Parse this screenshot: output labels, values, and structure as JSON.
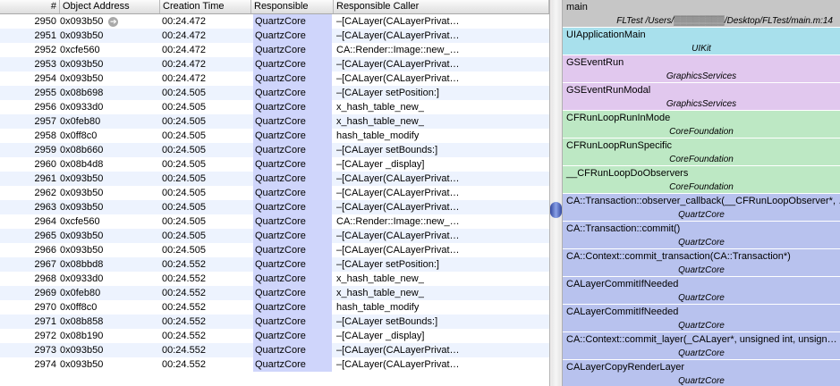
{
  "table": {
    "headers": {
      "num": "#",
      "addr": "Object Address",
      "time": "Creation Time",
      "resp": "Responsible",
      "caller": "Responsible Caller"
    },
    "rows": [
      {
        "num": "2950",
        "addr": "0x093b50",
        "time": "00:24.472",
        "resp": "QuartzCore",
        "caller": "–[CALayer(CALayerPrivat…"
      },
      {
        "num": "2951",
        "addr": "0x093b50",
        "time": "00:24.472",
        "resp": "QuartzCore",
        "caller": "–[CALayer(CALayerPrivat…"
      },
      {
        "num": "2952",
        "addr": "0xcfe560",
        "time": "00:24.472",
        "resp": "QuartzCore",
        "caller": "CA::Render::Image::new_…"
      },
      {
        "num": "2953",
        "addr": "0x093b50",
        "time": "00:24.472",
        "resp": "QuartzCore",
        "caller": "–[CALayer(CALayerPrivat…"
      },
      {
        "num": "2954",
        "addr": "0x093b50",
        "time": "00:24.472",
        "resp": "QuartzCore",
        "caller": "–[CALayer(CALayerPrivat…"
      },
      {
        "num": "2955",
        "addr": "0x08b698",
        "time": "00:24.505",
        "resp": "QuartzCore",
        "caller": "–[CALayer setPosition:]"
      },
      {
        "num": "2956",
        "addr": "0x0933d0",
        "time": "00:24.505",
        "resp": "QuartzCore",
        "caller": "x_hash_table_new_"
      },
      {
        "num": "2957",
        "addr": "0x0feb80",
        "time": "00:24.505",
        "resp": "QuartzCore",
        "caller": "x_hash_table_new_"
      },
      {
        "num": "2958",
        "addr": "0x0ff8c0",
        "time": "00:24.505",
        "resp": "QuartzCore",
        "caller": "hash_table_modify"
      },
      {
        "num": "2959",
        "addr": "0x08b660",
        "time": "00:24.505",
        "resp": "QuartzCore",
        "caller": "–[CALayer setBounds:]"
      },
      {
        "num": "2960",
        "addr": "0x08b4d8",
        "time": "00:24.505",
        "resp": "QuartzCore",
        "caller": "–[CALayer _display]"
      },
      {
        "num": "2961",
        "addr": "0x093b50",
        "time": "00:24.505",
        "resp": "QuartzCore",
        "caller": "–[CALayer(CALayerPrivat…"
      },
      {
        "num": "2962",
        "addr": "0x093b50",
        "time": "00:24.505",
        "resp": "QuartzCore",
        "caller": "–[CALayer(CALayerPrivat…"
      },
      {
        "num": "2963",
        "addr": "0x093b50",
        "time": "00:24.505",
        "resp": "QuartzCore",
        "caller": "–[CALayer(CALayerPrivat…"
      },
      {
        "num": "2964",
        "addr": "0xcfe560",
        "time": "00:24.505",
        "resp": "QuartzCore",
        "caller": "CA::Render::Image::new_…"
      },
      {
        "num": "2965",
        "addr": "0x093b50",
        "time": "00:24.505",
        "resp": "QuartzCore",
        "caller": "–[CALayer(CALayerPrivat…"
      },
      {
        "num": "2966",
        "addr": "0x093b50",
        "time": "00:24.505",
        "resp": "QuartzCore",
        "caller": "–[CALayer(CALayerPrivat…"
      },
      {
        "num": "2967",
        "addr": "0x08bbd8",
        "time": "00:24.552",
        "resp": "QuartzCore",
        "caller": "–[CALayer setPosition:]"
      },
      {
        "num": "2968",
        "addr": "0x0933d0",
        "time": "00:24.552",
        "resp": "QuartzCore",
        "caller": "x_hash_table_new_"
      },
      {
        "num": "2969",
        "addr": "0x0feb80",
        "time": "00:24.552",
        "resp": "QuartzCore",
        "caller": "x_hash_table_new_"
      },
      {
        "num": "2970",
        "addr": "0x0ff8c0",
        "time": "00:24.552",
        "resp": "QuartzCore",
        "caller": "hash_table_modify"
      },
      {
        "num": "2971",
        "addr": "0x08b858",
        "time": "00:24.552",
        "resp": "QuartzCore",
        "caller": "–[CALayer setBounds:]"
      },
      {
        "num": "2972",
        "addr": "0x08b190",
        "time": "00:24.552",
        "resp": "QuartzCore",
        "caller": "–[CALayer _display]"
      },
      {
        "num": "2973",
        "addr": "0x093b50",
        "time": "00:24.552",
        "resp": "QuartzCore",
        "caller": "–[CALayer(CALayerPrivat…"
      },
      {
        "num": "2974",
        "addr": "0x093b50",
        "time": "00:24.552",
        "resp": "QuartzCore",
        "caller": "–[CALayer(CALayerPrivat…"
      }
    ]
  },
  "stack": {
    "frames": [
      {
        "fn": "main",
        "lib": "FLTest /Users/▒▒▒▒▒▒▒▒/Desktop/FLTest/main.m:14",
        "color": "#c6c6c6",
        "kind": "main"
      },
      {
        "fn": "UIApplicationMain",
        "lib": "UIKit",
        "color": "#a8e0ec"
      },
      {
        "fn": "GSEventRun",
        "lib": "GraphicsServices",
        "color": "#e1c8ee"
      },
      {
        "fn": "GSEventRunModal",
        "lib": "GraphicsServices",
        "color": "#e1c8ee"
      },
      {
        "fn": "CFRunLoopRunInMode",
        "lib": "CoreFoundation",
        "color": "#bde8c4"
      },
      {
        "fn": "CFRunLoopRunSpecific",
        "lib": "CoreFoundation",
        "color": "#bde8c4"
      },
      {
        "fn": "__CFRunLoopDoObservers",
        "lib": "CoreFoundation",
        "color": "#bde8c4"
      },
      {
        "fn": "CA::Transaction::observer_callback(__CFRunLoopObserver*, …",
        "lib": "QuartzCore",
        "color": "#b8c2ee"
      },
      {
        "fn": "CA::Transaction::commit()",
        "lib": "QuartzCore",
        "color": "#b8c2ee"
      },
      {
        "fn": "CA::Context::commit_transaction(CA::Transaction*)",
        "lib": "QuartzCore",
        "color": "#b8c2ee"
      },
      {
        "fn": "CALayerCommitIfNeeded",
        "lib": "QuartzCore",
        "color": "#b8c2ee"
      },
      {
        "fn": "CALayerCommitIfNeeded",
        "lib": "QuartzCore",
        "color": "#b8c2ee"
      },
      {
        "fn": "CA::Context::commit_layer(_CALayer*, unsigned int, unsign…",
        "lib": "QuartzCore",
        "color": "#b8c2ee"
      },
      {
        "fn": "CALayerCopyRenderLayer",
        "lib": "QuartzCore",
        "color": "#b8c2ee"
      }
    ]
  },
  "icons": {
    "row_arrow": "go-arrow-icon",
    "split_thumb": "splitter-handle-icon"
  }
}
